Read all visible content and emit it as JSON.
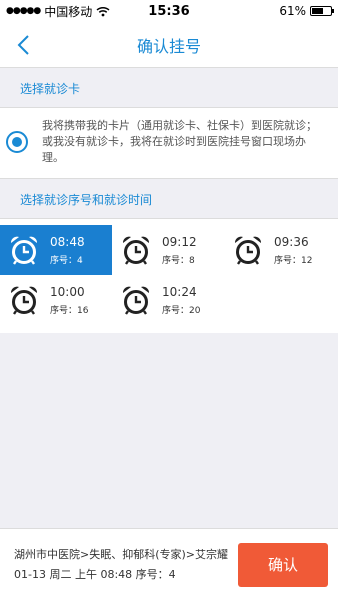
{
  "status_bar": {
    "carrier": "中国移动",
    "time": "15:36",
    "battery": "61%",
    "battery_level": 0.61
  },
  "nav": {
    "title": "确认挂号"
  },
  "card_section": {
    "label": "选择就诊卡",
    "option_text": "我将携带我的卡片（通用就诊卡、社保卡）到医院就诊；或我没有就诊卡，我将在就诊时到医院挂号窗口现场办理。",
    "selected": true
  },
  "slot_section": {
    "label": "选择就诊序号和就诊时间",
    "slots": [
      {
        "time": "08:48",
        "num": "序号：4",
        "selected": true
      },
      {
        "time": "09:12",
        "num": "序号：8",
        "selected": false
      },
      {
        "time": "09:36",
        "num": "序号：12",
        "selected": false
      },
      {
        "time": "10:00",
        "num": "序号：16",
        "selected": false
      },
      {
        "time": "10:24",
        "num": "序号：20",
        "selected": false
      }
    ]
  },
  "bottom": {
    "department": "湖州市中医院>失眠、抑郁科(专家)>艾宗耀",
    "summary": "01-13 周二 上午 08:48 序号：4",
    "confirm_label": "确认"
  },
  "colors": {
    "accent": "#1a8ad4",
    "selected_slot": "#1a7fd0",
    "confirm": "#f05a37"
  }
}
